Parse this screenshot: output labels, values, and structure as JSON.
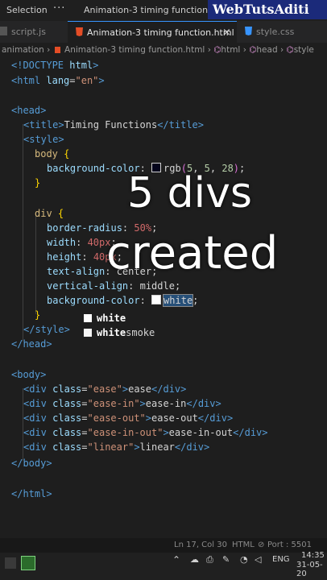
{
  "menubar": {
    "selection": "Selection",
    "more": "···",
    "title": "Animation-3 timing function.html"
  },
  "brand": "WebTutsAditi",
  "tabs": [
    {
      "label": "script.js"
    },
    {
      "label": "Animation-3 timing function.html",
      "close": "×"
    },
    {
      "label": "style.css"
    }
  ],
  "breadcrumb": {
    "folder": "animation",
    "sep": "›",
    "file": "Animation-3 timing function.html",
    "n1": "html",
    "n2": "head",
    "n3": "style"
  },
  "code": {
    "l1": {
      "a": "<!DOCTYPE ",
      "b": "html",
      "c": ">"
    },
    "l2": {
      "a": "<",
      "b": "html",
      "c": " lang",
      "d": "=",
      "e": "\"en\"",
      "f": ">"
    },
    "l4": {
      "a": "<",
      "b": "head",
      "c": ">"
    },
    "l5": {
      "a": "<",
      "b": "title",
      "c": ">",
      "d": "Timing Functions",
      "e": "</",
      "f": "title",
      "g": ">"
    },
    "l6": {
      "a": "<",
      "b": "style",
      "c": ">"
    },
    "l7": {
      "a": "body",
      "b": " {"
    },
    "l8": {
      "a": "background-color",
      "b": ": ",
      "c": "rgb",
      "d": "(",
      "e": "5",
      "f": ", ",
      "g": "5",
      "h": ", ",
      "i": "28",
      "j": ")",
      "k": ";"
    },
    "l9": "}",
    "l11": {
      "a": "div",
      "b": " {"
    },
    "l12": {
      "a": "border-radius",
      "b": ": ",
      "c": "50%",
      "d": ";"
    },
    "l13": {
      "a": "width",
      "b": ": ",
      "c": "40px",
      "d": ";"
    },
    "l14": {
      "a": "height",
      "b": ": ",
      "c": "40px",
      "d": ";"
    },
    "l15": {
      "a": "text-align",
      "b": ": ",
      "c": "center",
      "d": ";"
    },
    "l16": {
      "a": "vertical-align",
      "b": ": ",
      "c": "middle",
      "d": ";"
    },
    "l17": {
      "a": "background-color",
      "b": ": ",
      "c": "white",
      "d": ";"
    },
    "l18": "}",
    "l19": {
      "a": "</",
      "b": "style",
      "c": ">"
    },
    "l20": {
      "a": "</",
      "b": "head",
      "c": ">"
    },
    "l22": {
      "a": "<",
      "b": "body",
      "c": ">"
    },
    "divs": [
      {
        "cls": "\"ease\"",
        "txt": "ease"
      },
      {
        "cls": "\"ease-in\"",
        "txt": "ease-in"
      },
      {
        "cls": "\"ease-out\"",
        "txt": "ease-out"
      },
      {
        "cls": "\"ease-in-out\"",
        "txt": "ease-in-out"
      },
      {
        "cls": "\"linear\"",
        "txt": "linear"
      }
    ],
    "div_open": "<",
    "div_tag": "div",
    "class_attr": " class",
    "eq": "=",
    "gt": ">",
    "close_open": "</",
    "l28": {
      "a": "</",
      "b": "body",
      "c": ">"
    },
    "l30": {
      "a": "</",
      "b": "html",
      "c": ">"
    }
  },
  "suggest": [
    {
      "match": "white",
      "rest": ""
    },
    {
      "match": "white",
      "rest": "smoke"
    }
  ],
  "caption": {
    "line1": "5 divs",
    "line2": "created"
  },
  "status": {
    "pos": "Ln 17, Col 30",
    "lang": "HTML",
    "port": "Port : 5501"
  },
  "taskbar": {
    "lang": "ENG",
    "time": "14:35",
    "date": "31-05-20"
  },
  "colors": {
    "bg": "#1e1e1e",
    "accent": "#3794ff",
    "brand_bg": "#1b2a7a"
  }
}
